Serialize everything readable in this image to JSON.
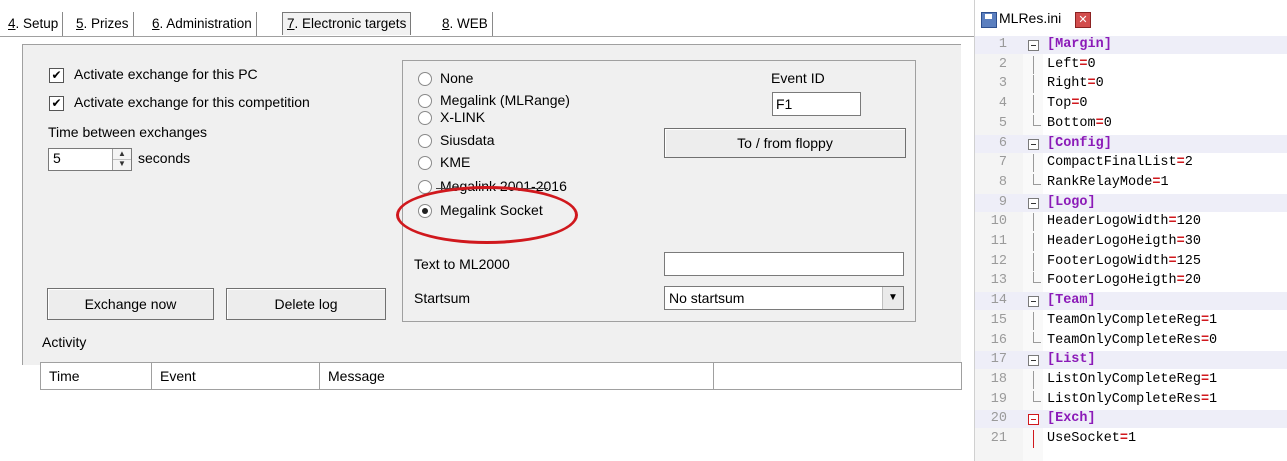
{
  "tabs": [
    {
      "num": "4",
      "label": ". Setup"
    },
    {
      "num": "5",
      "label": ". Prizes"
    },
    {
      "num": "6",
      "label": ". Administration"
    },
    {
      "num": "7",
      "label": ". Electronic targets"
    },
    {
      "num": "8",
      "label": ". WEB"
    }
  ],
  "exchange": {
    "activate_pc": "Activate exchange for this PC",
    "activate_comp": "Activate exchange for this competition",
    "time_label": "Time between exchanges",
    "time_value": "5",
    "seconds": "seconds",
    "exchange_now": "Exchange now",
    "delete_log": "Delete log",
    "activity": "Activity"
  },
  "options": {
    "radios": [
      "None",
      "Megalink (MLRange)",
      "X-LINK",
      "Siusdata",
      "KME",
      "Megalink 2001-2016",
      "Megalink Socket"
    ],
    "selected_index": 6,
    "event_id_label": "Event ID",
    "event_id_value": "F1",
    "floppy_button": "To / from floppy",
    "text_to_ml": "Text to ML2000",
    "text_to_ml_value": "",
    "startsum_label": "Startsum",
    "startsum_value": "No startsum"
  },
  "grid": {
    "columns": [
      "Time",
      "Event",
      "Message"
    ]
  },
  "editor": {
    "filename": "MLRes.ini",
    "lines": [
      {
        "n": "1",
        "key": "[Margin]",
        "val": ""
      },
      {
        "n": "2",
        "key": "Left",
        "val": "0"
      },
      {
        "n": "3",
        "key": "Right",
        "val": "0"
      },
      {
        "n": "4",
        "key": "Top",
        "val": "0"
      },
      {
        "n": "5",
        "key": "Bottom",
        "val": "0"
      },
      {
        "n": "6",
        "key": "[Config]",
        "val": ""
      },
      {
        "n": "7",
        "key": "CompactFinalList",
        "val": "2"
      },
      {
        "n": "8",
        "key": "RankRelayMode",
        "val": "1"
      },
      {
        "n": "9",
        "key": "[Logo]",
        "val": ""
      },
      {
        "n": "10",
        "key": "HeaderLogoWidth",
        "val": "120"
      },
      {
        "n": "11",
        "key": "HeaderLogoHeigth",
        "val": "30"
      },
      {
        "n": "12",
        "key": "FooterLogoWidth",
        "val": "125"
      },
      {
        "n": "13",
        "key": "FooterLogoHeigth",
        "val": "20"
      },
      {
        "n": "14",
        "key": "[Team]",
        "val": ""
      },
      {
        "n": "15",
        "key": "TeamOnlyCompleteReg",
        "val": "1"
      },
      {
        "n": "16",
        "key": "TeamOnlyCompleteRes",
        "val": "0"
      },
      {
        "n": "17",
        "key": "[List]",
        "val": ""
      },
      {
        "n": "18",
        "key": "ListOnlyCompleteReg",
        "val": "1"
      },
      {
        "n": "19",
        "key": "ListOnlyCompleteRes",
        "val": "1"
      },
      {
        "n": "20",
        "key": "[Exch]",
        "val": ""
      },
      {
        "n": "21",
        "key": "UseSocket",
        "val": "1"
      }
    ]
  }
}
